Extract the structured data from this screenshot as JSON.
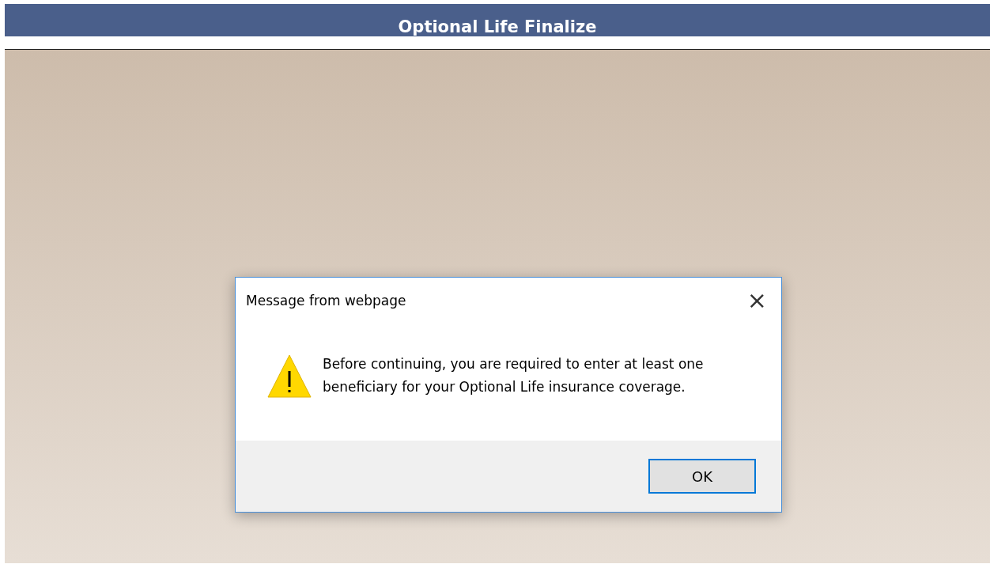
{
  "header": {
    "title": "Optional Life Finalize"
  },
  "dialog": {
    "title": "Message from webpage",
    "close": "×",
    "message": "Before continuing, you are required to enter at least one beneficiary for your Optional Life insurance coverage.",
    "buttons": [
      {
        "label": "OK",
        "focused": true
      }
    ]
  }
}
